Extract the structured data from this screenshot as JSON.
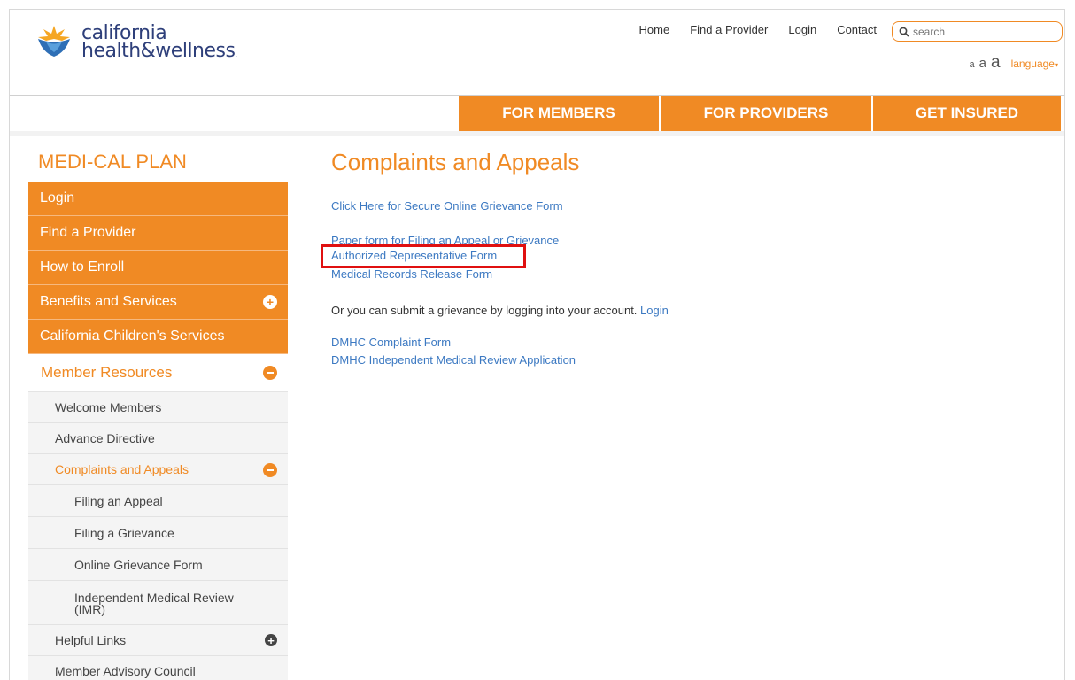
{
  "brand": {
    "line1": "california",
    "line2": "health&wellness",
    "tm": "."
  },
  "top_nav": [
    "Home",
    "Find a Provider",
    "Login",
    "Contact"
  ],
  "search": {
    "placeholder": "search"
  },
  "text_size": {
    "small": "a",
    "medium": "a",
    "large": "a"
  },
  "language": "language",
  "main_nav": {
    "members": "FOR MEMBERS",
    "providers": "FOR PROVIDERS",
    "insured": "GET INSURED"
  },
  "sidebar": {
    "title": "MEDI-CAL PLAN",
    "items": [
      "Login",
      "Find a Provider",
      "How to Enroll",
      "Benefits and Services",
      "California Children's Services"
    ],
    "member_resources": "Member Resources",
    "subs": {
      "welcome": "Welcome Members",
      "advance": "Advance Directive",
      "complaints": "Complaints and Appeals",
      "helpful": "Helpful Links",
      "advisory": "Member Advisory Council"
    },
    "subsubs": [
      "Filing an Appeal",
      "Filing a Grievance",
      "Online Grievance Form"
    ],
    "imr_line1": "Independent Medical Review",
    "imr_line2": "(IMR)"
  },
  "content": {
    "title": "Complaints and Appeals",
    "secure_form": "Click Here for Secure Online Grievance Form",
    "paper_form": "Paper form for Filing an Appeal or Grievance",
    "auth_rep": "Authorized Representative Form",
    "medical_records": "Medical Records Release Form",
    "submit_text": "Or you can submit a grievance by logging into your account.",
    "login_link": "Login",
    "dmhc_complaint": "DMHC Complaint Form",
    "dmhc_imr": "DMHC Independent Medical Review Application"
  },
  "colors": {
    "accent": "#f08a24",
    "link": "#3c79c2",
    "brand_navy": "#2e3f7a",
    "highlight": "#e01010"
  }
}
